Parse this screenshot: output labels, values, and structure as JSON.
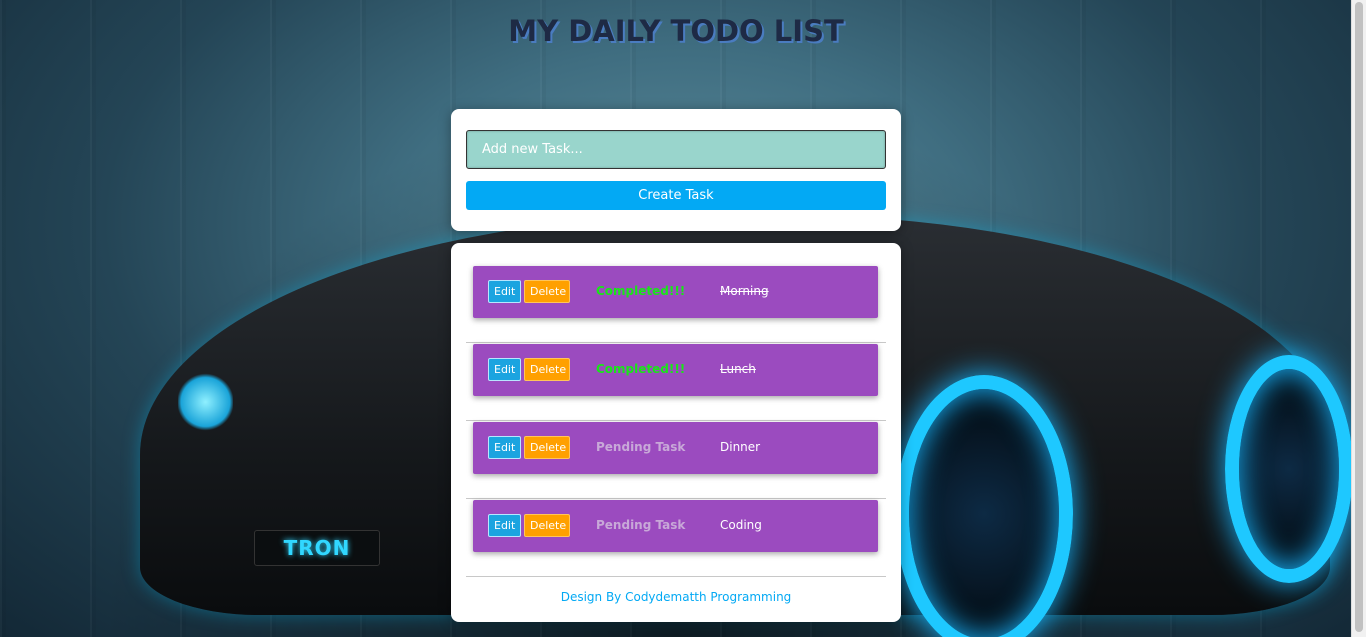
{
  "header": {
    "title": "MY DAILY TODO LIST"
  },
  "form": {
    "placeholder": "Add new Task...",
    "create_label": "Create Task"
  },
  "tasks": [
    {
      "edit_label": "Edit",
      "delete_label": "Delete",
      "status": "Completed!!!",
      "name": "Morning",
      "completed": true
    },
    {
      "edit_label": "Edit",
      "delete_label": "Delete",
      "status": "Completed!!!",
      "name": "Lunch",
      "completed": true
    },
    {
      "edit_label": "Edit",
      "delete_label": "Delete",
      "status": "Pending Task",
      "name": "Dinner",
      "completed": false
    },
    {
      "edit_label": "Edit",
      "delete_label": "Delete",
      "status": "Pending Task",
      "name": "Coding",
      "completed": false
    }
  ],
  "background": {
    "plate_text": "TRON"
  },
  "footer": {
    "credit": "Design By Codydematth Programming"
  },
  "colors": {
    "accent": "#03a9f4",
    "task_bg": "#9b4bbf",
    "delete": "#ffa000",
    "completed_text": "#19e619",
    "input_bg": "#99d5cc"
  }
}
